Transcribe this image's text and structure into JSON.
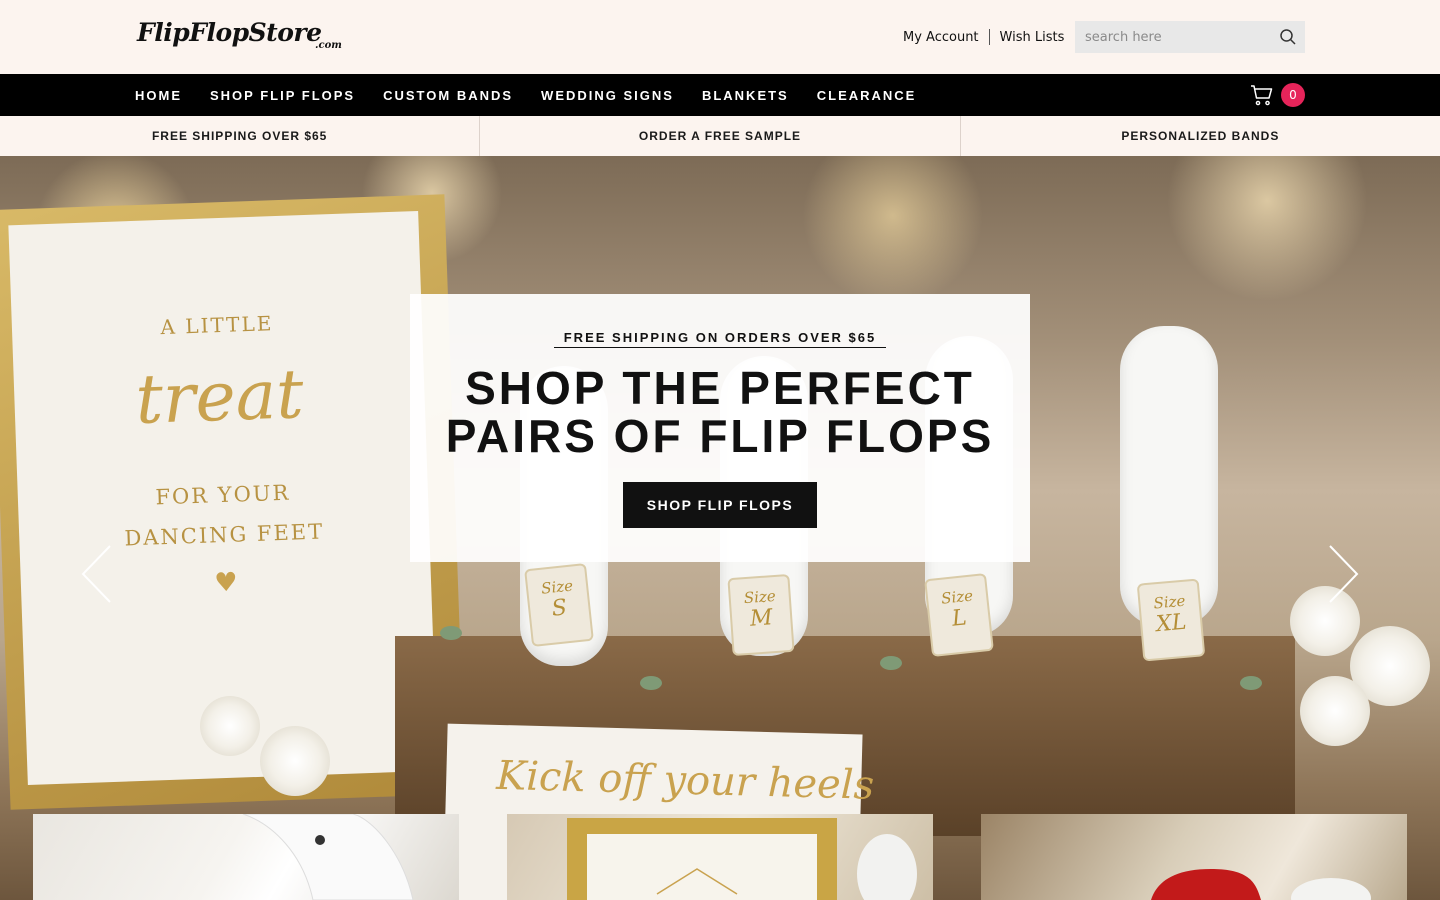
{
  "header": {
    "logo_text": "FlipFlopStore",
    "logo_suffix": ".com",
    "my_account": "My Account",
    "wish_lists": "Wish Lists",
    "search_placeholder": "search here"
  },
  "nav": {
    "items": [
      "HOME",
      "SHOP FLIP FLOPS",
      "CUSTOM BANDS",
      "WEDDING SIGNS",
      "BLANKETS",
      "CLEARANCE"
    ],
    "cart_count": "0"
  },
  "promo": [
    "FREE SHIPPING OVER $65",
    "ORDER A FREE SAMPLE",
    "PERSONALIZED BANDS"
  ],
  "hero": {
    "eyebrow": "FREE SHIPPING ON ORDERS OVER $65",
    "title_line1": "SHOP THE PERFECT",
    "title_line2": "PAIRS OF FLIP FLOPS",
    "button": "SHOP FLIP FLOPS",
    "sign_line1": "A LITTLE",
    "sign_script": "treat",
    "sign_line2": "FOR YOUR",
    "sign_line3": "DANCING FEET",
    "tag_label": "Size",
    "sizes": [
      "S",
      "M",
      "L",
      "XL"
    ],
    "kick_text": "Kick off your heels"
  },
  "colors": {
    "header_bg": "#fcf4ef",
    "nav_bg": "#000000",
    "badge": "#e6245a",
    "accent_gold": "#c9a24f"
  }
}
